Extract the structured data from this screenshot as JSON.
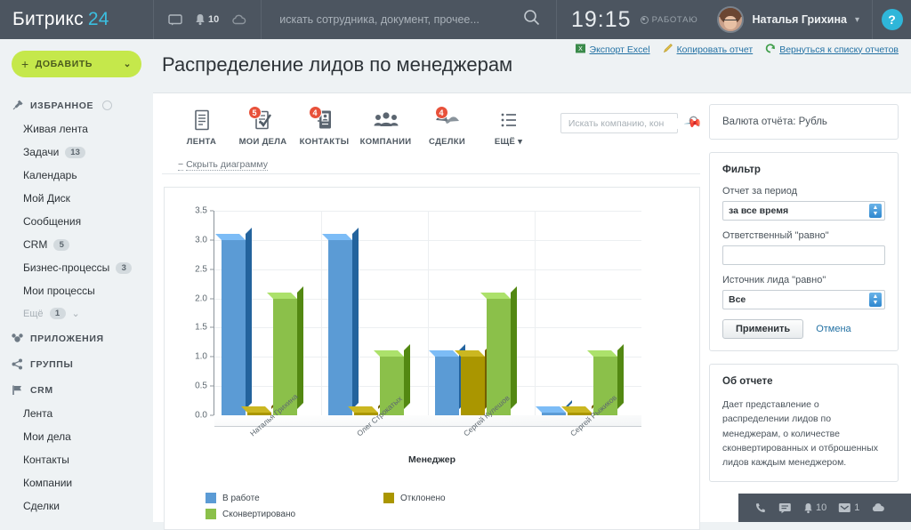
{
  "topbar": {
    "logo_text": "Битрикс",
    "logo_num": "24",
    "chat_icon": "chat-icon",
    "bell_icon": "bell-icon",
    "bell_count": "10",
    "cloud_icon": "cloud-icon",
    "search_placeholder": "искать сотрудника, документ, прочее...",
    "search_value": "",
    "search_icon": "search-icon",
    "time": "19:15",
    "status": "РАБОТАЮ",
    "user_name": "Наталья Грихина",
    "caret": "▾",
    "help_label": "?"
  },
  "sidebar": {
    "add_button": "ДОБАВИТЬ",
    "add_plus": "+",
    "add_caret": "⌄",
    "sections": [
      {
        "title": "ИЗБРАННОЕ",
        "icon": "pin-icon",
        "has_gear": true,
        "items": [
          {
            "label": "Живая лента",
            "count": ""
          },
          {
            "label": "Задачи",
            "count": "13"
          },
          {
            "label": "Календарь",
            "count": ""
          },
          {
            "label": "Мой Диск",
            "count": ""
          },
          {
            "label": "Сообщения",
            "count": ""
          },
          {
            "label": "CRM",
            "count": "5"
          },
          {
            "label": "Бизнес-процессы",
            "count": "3"
          },
          {
            "label": "Мои процессы",
            "count": ""
          },
          {
            "label": "Ещё",
            "count": "1",
            "dim": true
          }
        ]
      },
      {
        "title": "ПРИЛОЖЕНИЯ",
        "icon": "apps-icon",
        "has_gear": false,
        "items": []
      },
      {
        "title": "ГРУППЫ",
        "icon": "share-icon",
        "has_gear": false,
        "items": []
      },
      {
        "title": "CRM",
        "icon": "flag-icon",
        "has_gear": false,
        "items": [
          {
            "label": "Лента",
            "count": ""
          },
          {
            "label": "Мои дела",
            "count": ""
          },
          {
            "label": "Контакты",
            "count": ""
          },
          {
            "label": "Компании",
            "count": ""
          },
          {
            "label": "Сделки",
            "count": ""
          }
        ]
      }
    ]
  },
  "page": {
    "title": "Распределение лидов по менеджерам",
    "links": [
      {
        "label": "Экспорт Excel",
        "icon": "excel-icon"
      },
      {
        "label": "Копировать отчет",
        "icon": "pencil-icon"
      },
      {
        "label": "Вернуться к списку отчетов",
        "icon": "back-icon"
      }
    ]
  },
  "crm_toolbar": {
    "items": [
      {
        "label": "ЛЕНТА",
        "icon": "document-icon",
        "badge": ""
      },
      {
        "label": "МОИ ДЕЛА",
        "icon": "checklist-icon",
        "badge": "5"
      },
      {
        "label": "КОНТАКТЫ",
        "icon": "contacts-icon",
        "badge": "4"
      },
      {
        "label": "КОМПАНИИ",
        "icon": "people-icon",
        "badge": ""
      },
      {
        "label": "СДЕЛКИ",
        "icon": "handshake-icon",
        "badge": "4"
      },
      {
        "label": "ЕЩЁ ▾",
        "icon": "list-icon",
        "badge": ""
      }
    ],
    "search_placeholder": "Искать компанию, кон",
    "search_value": "",
    "search_icon": "search-icon",
    "pin_icon": "pin-icon"
  },
  "chart_panel": {
    "hide_link": "Скрыть диаграмму",
    "hide_prefix": "−"
  },
  "chart_data": {
    "type": "bar",
    "title": "",
    "xlabel": "Менеджер",
    "ylabel": "",
    "categories": [
      "Наталья Грихина",
      "Олег Строкатых",
      "Сергей Кулешов",
      "Сергей Рыжиков"
    ],
    "series": [
      {
        "name": "В работе",
        "color": "#5b9bd5",
        "values": [
          3,
          3,
          1,
          0.03
        ]
      },
      {
        "name": "Отклонено",
        "color": "#aa9600",
        "values": [
          0.03,
          0.03,
          1,
          0.03
        ]
      },
      {
        "name": "Сконвертировано",
        "color": "#8bc04a",
        "values": [
          2,
          1,
          2,
          1
        ]
      }
    ],
    "legend_order": [
      "В работе",
      "Отклонено",
      "Сконвертировано"
    ],
    "ylim": [
      0,
      3.5
    ],
    "yticks": [
      "0.0",
      "0.5",
      "1.0",
      "1.5",
      "2.0",
      "2.5",
      "3.0",
      "3.5"
    ],
    "grid": true,
    "legend_position": "bottom"
  },
  "currency_panel": {
    "text": "Валюта отчёта: Рубль"
  },
  "filter_panel": {
    "title": "Фильтр",
    "period_label": "Отчет за период",
    "period_value": "за все время",
    "responsible_label": "Ответственный \"равно\"",
    "responsible_value": "",
    "source_label": "Источник лида \"равно\"",
    "source_value": "Все",
    "apply_label": "Применить",
    "cancel_label": "Отмена"
  },
  "about_panel": {
    "title": "Об отчете",
    "text": "Дает представление о распределении лидов по менеджерам, о количестве сконвертированных и отброшенных лидов каждым менеджером."
  },
  "bottombar": {
    "phone_icon": "phone-icon",
    "chat_icon": "chat-icon",
    "bell_icon": "bell-icon",
    "bell_count": "10",
    "mail_icon": "mail-icon",
    "mail_count": "1",
    "cloud_icon": "cloud-icon"
  }
}
